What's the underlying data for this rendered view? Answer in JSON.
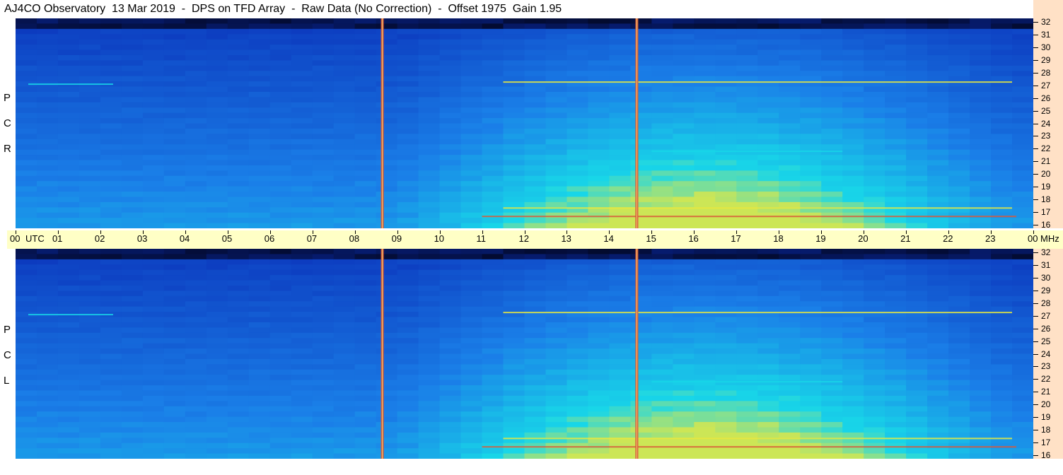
{
  "title": "AJ4CO Observatory  13 Mar 2019  -  DPS on TFD Array  -  Raw Data (No Correction)  -  Offset 1975  Gain 1.95",
  "panels": [
    {
      "id": "rcp",
      "letters": [
        "P",
        "C",
        "R"
      ]
    },
    {
      "id": "lcp",
      "letters": [
        "P",
        "C",
        "L"
      ]
    }
  ],
  "time_axis": {
    "labels": [
      "00",
      "01",
      "02",
      "03",
      "04",
      "05",
      "06",
      "07",
      "08",
      "09",
      "10",
      "11",
      "12",
      "13",
      "14",
      "15",
      "16",
      "17",
      "18",
      "19",
      "20",
      "21",
      "22",
      "23",
      "00"
    ],
    "unit_left": "UTC",
    "unit_right": "MHz"
  },
  "freq_axis": {
    "labels": [
      "32",
      "31",
      "30",
      "29",
      "28",
      "27",
      "26",
      "25",
      "24",
      "23",
      "22",
      "21",
      "20",
      "19",
      "18",
      "17",
      "16"
    ]
  },
  "colors": {
    "background_dark": "#02051a",
    "low": "#0a2fb8",
    "mid": "#1a7fe8",
    "high": "#18d6e8",
    "hot": "#e8e840",
    "marker": "#d85a3a",
    "axis_time_bg": "#ffffc6",
    "axis_freq_bg": "#ffe1c6"
  },
  "chart_data": [
    {
      "type": "heatmap",
      "name": "RCP",
      "x_range": [
        "00 UTC",
        "00 UTC next day"
      ],
      "y_range": [
        16,
        32
      ],
      "y_unit": "MHz",
      "vertical_markers_utc": [
        8.65,
        14.65
      ],
      "notes": "spectrogram; brighter (higher level) toward lower frequencies and during ~11-23 UTC"
    },
    {
      "type": "heatmap",
      "name": "LCP",
      "x_range": [
        "00 UTC",
        "00 UTC next day"
      ],
      "y_range": [
        16,
        32
      ],
      "y_unit": "MHz",
      "vertical_markers_utc": [
        8.65,
        14.65
      ],
      "notes": "spectrogram; brighter (higher level) toward lower frequencies and during ~11-23 UTC"
    }
  ]
}
